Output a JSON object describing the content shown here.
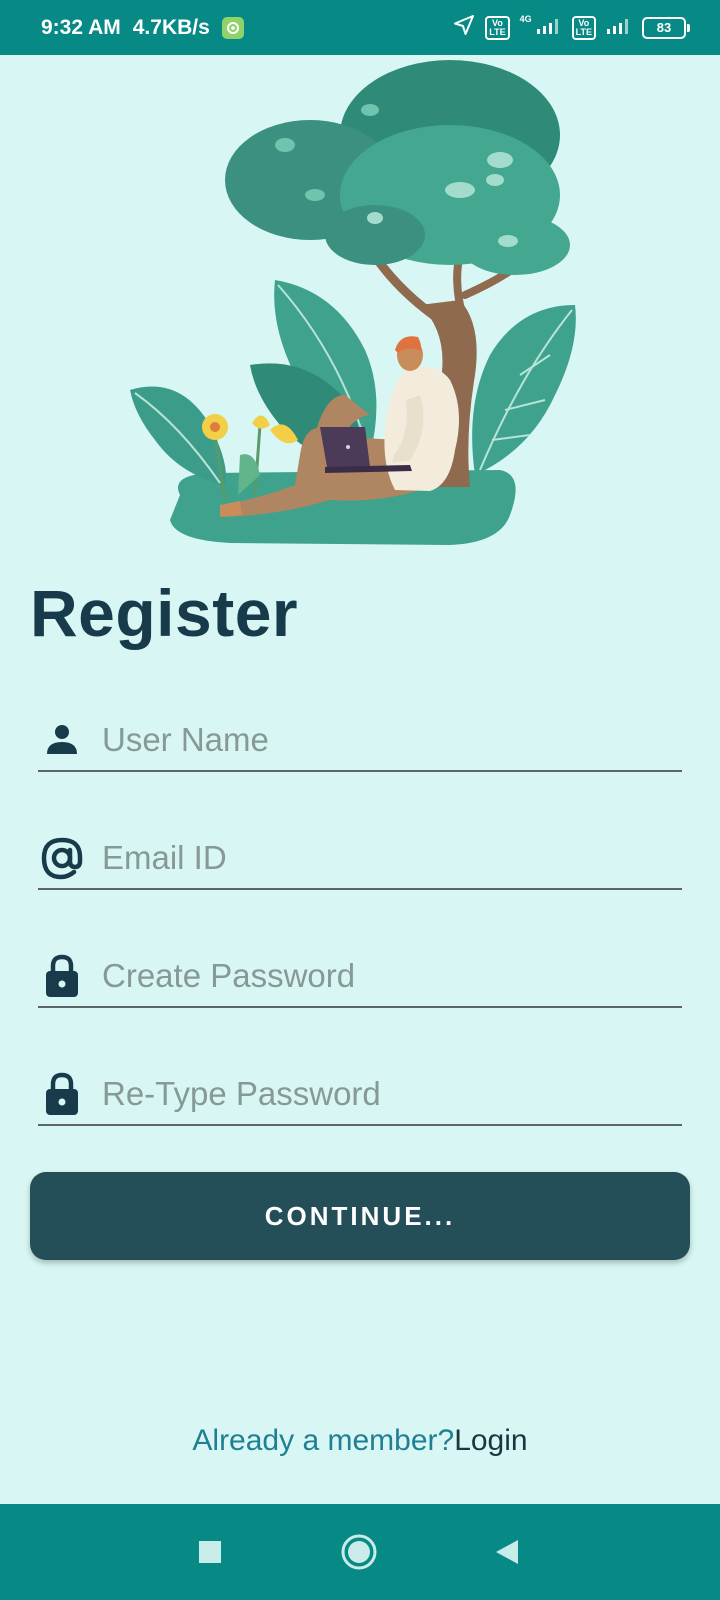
{
  "status_bar": {
    "time": "9:32 AM",
    "net_speed": "4.7KB/s",
    "network_type": "4G",
    "volte_label": "Vo\nLTE",
    "battery_level": "83",
    "icons": [
      "settings-app-icon",
      "location-arrow-icon",
      "volte-icon",
      "signal-icon",
      "volte-icon",
      "signal-icon",
      "battery-icon"
    ]
  },
  "page": {
    "title": "Register",
    "illustration": "person-with-laptop-under-tree-illustration"
  },
  "form": {
    "username": {
      "placeholder": "User Name",
      "value": "",
      "icon": "person-icon"
    },
    "email": {
      "placeholder": "Email ID",
      "value": "",
      "icon": "at-sign-icon"
    },
    "password": {
      "placeholder": "Create Password",
      "value": "",
      "icon": "lock-icon"
    },
    "retype_password": {
      "placeholder": "Re-Type Password",
      "value": "",
      "icon": "lock-icon"
    },
    "continue_label": "CONTINUE..."
  },
  "footer": {
    "prompt": "Already a member?",
    "login_label": "Login"
  },
  "nav_bar": {
    "icons": [
      "recents-square-icon",
      "home-circle-icon",
      "back-triangle-icon"
    ]
  },
  "colors": {
    "status_bar": "#078a86",
    "background": "#d8f7f4",
    "title": "#173b4a",
    "button": "#244f58",
    "link_prompt": "#217f95"
  }
}
